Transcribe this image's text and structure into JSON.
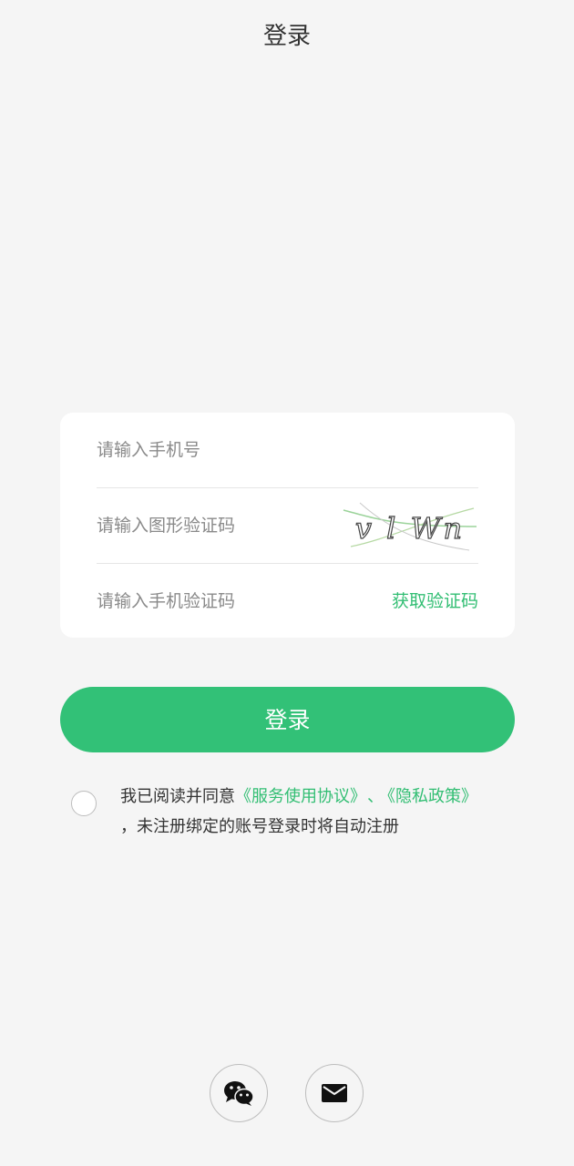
{
  "header": {
    "title": "登录"
  },
  "form": {
    "phone_placeholder": "请输入手机号",
    "captcha_placeholder": "请输入图形验证码",
    "captcha_image_text": "v l Wn",
    "sms_placeholder": "请输入手机验证码",
    "get_code_label": "获取验证码"
  },
  "login_button": {
    "label": "登录"
  },
  "agreement": {
    "checked": false,
    "prefix": "我已阅读并同意",
    "service_link": "《服务使用协议》",
    "separator": "、",
    "privacy_link": "《隐私政策》",
    "suffix": "，未注册绑定的账号登录时将自动注册"
  },
  "social_login": {
    "wechat_icon": "wechat-icon",
    "mail_icon": "mail-icon"
  },
  "colors": {
    "accent": "#32c177",
    "background": "#f5f5f5",
    "card": "#ffffff"
  }
}
